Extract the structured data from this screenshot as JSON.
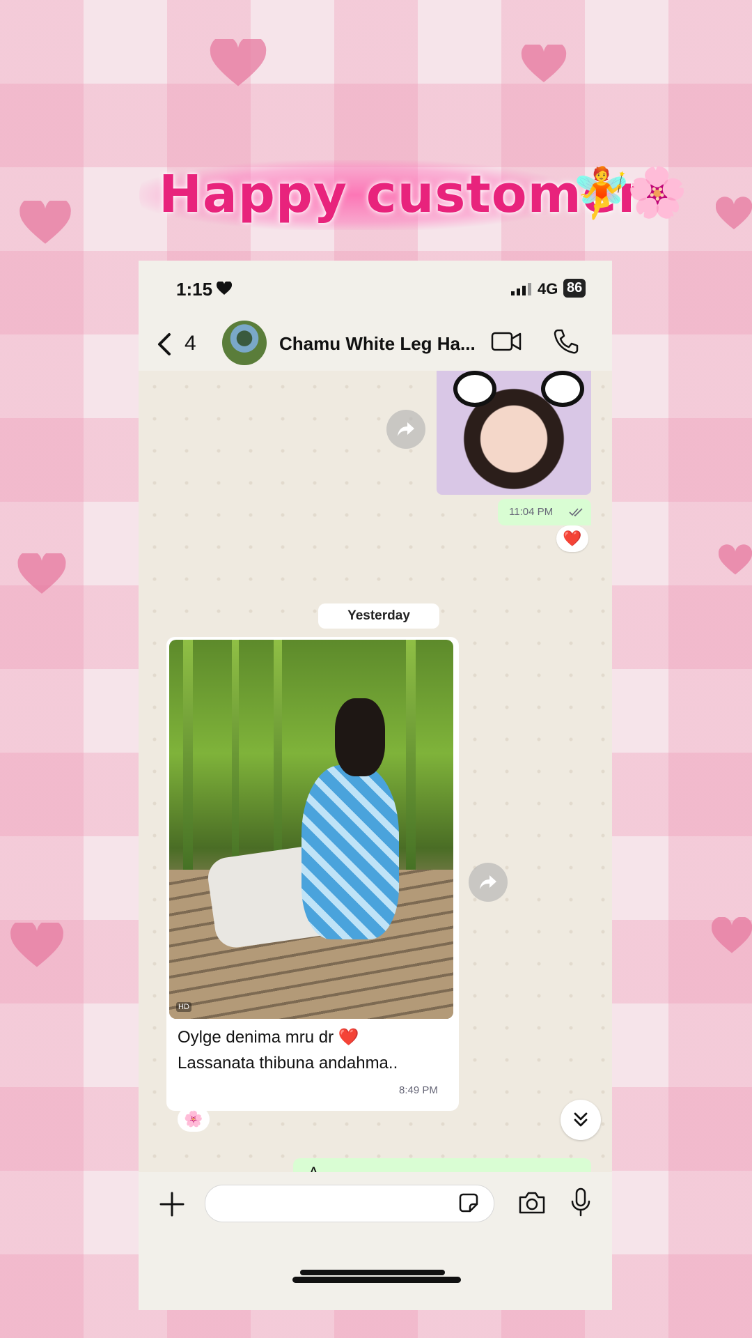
{
  "overlay": {
    "title": "Happy customer",
    "title_emoji_fairy": "🧚",
    "title_emoji_flower": "🌸",
    "title_color": "#e8237c"
  },
  "status_bar": {
    "time": "1:15",
    "network": "4G",
    "battery": "86"
  },
  "header": {
    "back_count": "4",
    "contact_name": "Chamu White Leg Ha...",
    "icons": [
      "back-icon",
      "video-call-icon",
      "voice-call-icon"
    ]
  },
  "messages": {
    "outgoing_image_time": "11:04 PM",
    "outgoing_reaction": "❤️",
    "date_separator": "Yesterday",
    "incoming_caption_line1": "Oylge denima mru dr ❤️",
    "incoming_caption_line2": "Lassanata thibuna andahma..",
    "incoming_time": "8:49 PM",
    "incoming_reaction": "🌸",
    "hd_badge": "HD",
    "partial_message": "A"
  },
  "input_bar": {
    "placeholder": "",
    "icons": [
      "plus-icon",
      "sticker-icon",
      "camera-icon",
      "mic-icon"
    ]
  },
  "colors": {
    "outgoing_bubble": "#d9fdd3",
    "incoming_bubble": "#ffffff",
    "chat_bg": "#efeae0"
  }
}
